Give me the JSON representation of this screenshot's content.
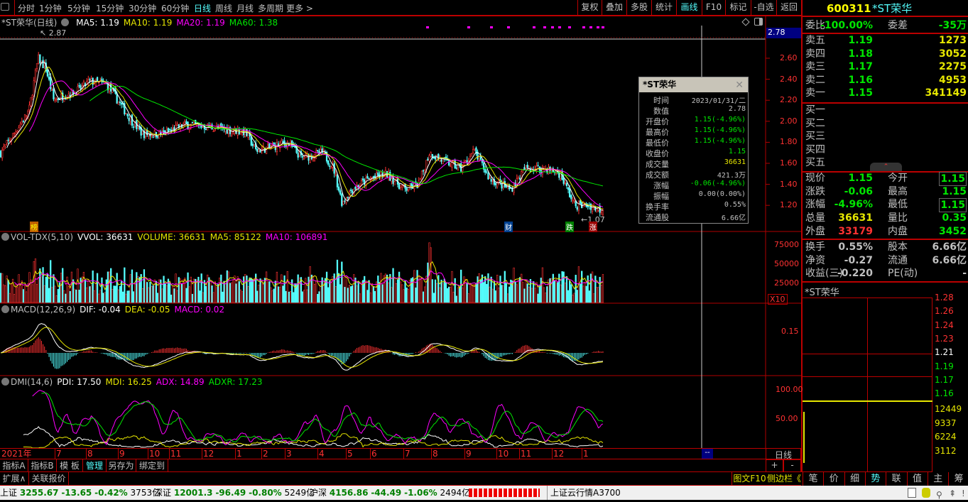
{
  "toolbar": {
    "periods": [
      "分时",
      "1分钟",
      "5分钟",
      "15分钟",
      "30分钟",
      "60分钟",
      "日线",
      "周线",
      "月线",
      "多周期",
      "更多 >"
    ],
    "active": "日线",
    "buttons": [
      "复权",
      "叠加",
      "多股",
      "统计",
      "画线",
      "F10",
      "标记",
      "-自选",
      "返回"
    ]
  },
  "main": {
    "title": "*ST荣华(日线)",
    "ma5": "MA5: 1.19",
    "ma10": "MA10: 1.19",
    "ma20": "MA20: 1.19",
    "ma60": "MA60: 1.38",
    "high_mark": "2.87",
    "low_mark": "1.07",
    "cursor_value": "2.78",
    "price_ticks": [
      "2.60",
      "2.40",
      "2.20",
      "2.00",
      "1.80",
      "1.60",
      "1.40",
      "1.20"
    ],
    "badges": [
      "榜",
      "财",
      "跌",
      "涨"
    ]
  },
  "vol": {
    "name": "VOL-TDX(5,10)",
    "vvol": "VVOL: 36631",
    "volume": "VOLUME: 36631",
    "ma5": "MA5: 85122",
    "ma10": "MA10: 106891",
    "ticks": [
      "75000",
      "50000",
      "25000"
    ],
    "unit": "X10"
  },
  "macd": {
    "name": "MACD(12,26,9)",
    "dif": "DIF: -0.04",
    "dea": "DEA: -0.05",
    "macd": "MACD: 0.02",
    "tick": "0.15"
  },
  "dmi": {
    "name": "DMI(14,6)",
    "pdi": "PDI: 17.50",
    "mdi": "MDI: 16.25",
    "adx": "ADX: 14.89",
    "adxr": "ADXR: 17.23",
    "ticks": [
      "100.00",
      "50.00"
    ]
  },
  "xaxis": {
    "labels": [
      "2021年",
      "7",
      "8",
      "9",
      "10",
      "11",
      "12",
      "1",
      "2",
      "3",
      "4",
      "5",
      "6",
      "7",
      "8",
      "9",
      "10",
      "11",
      "12",
      "1"
    ],
    "cursor": "--",
    "period": "日线",
    "plus": "+",
    "minus": "-"
  },
  "bottom_tabs": [
    "指标A",
    "指标B",
    "模 板",
    "管理",
    "另存为",
    "绑定到"
  ],
  "ext_tabs": [
    "扩展∧",
    "关联报价"
  ],
  "tooltip": {
    "title": "*ST荣华",
    "rows": [
      {
        "k": "时间",
        "v": "2023/01/31/二",
        "c": "#c0c0c0"
      },
      {
        "k": "数值",
        "v": "2.78",
        "c": "#c0c0c0"
      },
      {
        "k": "开盘价",
        "v": "1.15(-4.96%)",
        "c": "#00e600"
      },
      {
        "k": "最高价",
        "v": "1.15(-4.96%)",
        "c": "#00e600"
      },
      {
        "k": "最低价",
        "v": "1.15(-4.96%)",
        "c": "#00e600"
      },
      {
        "k": "收盘价",
        "v": "1.15",
        "c": "#00e600"
      },
      {
        "k": "成交量",
        "v": "36631",
        "c": "#e6e600"
      },
      {
        "k": "成交额",
        "v": "421.3万",
        "c": "#c0c0c0"
      },
      {
        "k": "涨幅",
        "v": "-0.06(-4.96%)",
        "c": "#00e600"
      },
      {
        "k": "振幅",
        "v": "0.00(0.00%)",
        "c": "#c0c0c0"
      },
      {
        "k": "换手率",
        "v": "0.55%",
        "c": "#c0c0c0"
      },
      {
        "k": "流通股",
        "v": "6.66亿",
        "c": "#c0c0c0"
      }
    ]
  },
  "quote": {
    "code": "600311",
    "name": "*ST荣华",
    "weibi": {
      "l": "委比",
      "v": "-100.00%",
      "l2": "委差",
      "v2": "-35万"
    },
    "sells": [
      {
        "l": "卖五",
        "p": "1.19",
        "q": "1273"
      },
      {
        "l": "卖四",
        "p": "1.18",
        "q": "3052"
      },
      {
        "l": "卖三",
        "p": "1.17",
        "q": "2275"
      },
      {
        "l": "卖二",
        "p": "1.16",
        "q": "4953"
      },
      {
        "l": "卖一",
        "p": "1.15",
        "q": "341149"
      }
    ],
    "buys": [
      {
        "l": "买一"
      },
      {
        "l": "买二"
      },
      {
        "l": "买三"
      },
      {
        "l": "买四"
      },
      {
        "l": "买五"
      }
    ],
    "stats": [
      {
        "l": "现价",
        "v": "1.15",
        "l2": "今开",
        "v2": "1.15",
        "c": "g",
        "c2": "g"
      },
      {
        "l": "涨跌",
        "v": "-0.06",
        "l2": "最高",
        "v2": "1.15",
        "c": "g",
        "c2": "g"
      },
      {
        "l": "涨幅",
        "v": "-4.96%",
        "l2": "最低",
        "v2": "1.15",
        "c": "g",
        "c2": "g"
      },
      {
        "l": "总量",
        "v": "36631",
        "l2": "量比",
        "v2": "0.35",
        "c": "y",
        "c2": "g"
      },
      {
        "l": "外盘",
        "v": "33179",
        "l2": "内盘",
        "v2": "3452",
        "c": "r",
        "c2": "g"
      }
    ],
    "fin": [
      {
        "l": "换手",
        "v": "0.55%",
        "l2": "股本",
        "v2": "6.66亿"
      },
      {
        "l": "净资",
        "v": "-0.27",
        "l2": "流通",
        "v2": "6.66亿"
      },
      {
        "l": "收益(三)",
        "v": "-0.220",
        "l2": "PE(动)",
        "v2": "-"
      }
    ]
  },
  "mini": {
    "title": "*ST荣华",
    "ticks": [
      "1.28",
      "1.26",
      "1.24",
      "1.23",
      "1.21",
      "1.19",
      "1.17",
      "1.16"
    ],
    "vticks": [
      "12449",
      "9337",
      "6224",
      "3112"
    ]
  },
  "side_tabs": {
    "f10": "图文F10",
    "sidebar": "侧边栏《",
    "tabs": [
      "笔",
      "价",
      "细",
      "势",
      "联",
      "值",
      "主",
      "筹"
    ]
  },
  "status": {
    "sh": "上证",
    "sh_v": "3255.67",
    "sh_c": "-13.65",
    "sh_p": "-0.42%",
    "sh_a": "3753亿",
    "sz": "深证",
    "sz_v": "12001.3",
    "sz_c": "-96.49",
    "sz_p": "-0.80%",
    "sz_a": "5249亿",
    "hs": "沪深",
    "hs_v": "4156.86",
    "hs_c": "-44.49",
    "hs_p": "-1.06%",
    "hs_a": "2494亿",
    "cloud": "上证云行情A3700"
  },
  "chart_data": {
    "type": "candlestick",
    "ylim": [
      1.07,
      2.87
    ],
    "days": 400,
    "price_path": [
      [
        0,
        1.7
      ],
      [
        0.024,
        1.9
      ],
      [
        0.047,
        2.1
      ],
      [
        0.062,
        2.6
      ],
      [
        0.075,
        2.5
      ],
      [
        0.088,
        2.2
      ],
      [
        0.106,
        2.25
      ],
      [
        0.13,
        2.3
      ],
      [
        0.147,
        2.38
      ],
      [
        0.176,
        2.35
      ],
      [
        0.194,
        2.2
      ],
      [
        0.218,
        2.0
      ],
      [
        0.235,
        1.88
      ],
      [
        0.27,
        1.88
      ],
      [
        0.306,
        1.97
      ],
      [
        0.34,
        1.95
      ],
      [
        0.376,
        1.92
      ],
      [
        0.406,
        1.9
      ],
      [
        0.424,
        1.72
      ],
      [
        0.447,
        1.75
      ],
      [
        0.476,
        1.8
      ],
      [
        0.5,
        1.65
      ],
      [
        0.535,
        1.7
      ],
      [
        0.553,
        1.55
      ],
      [
        0.567,
        1.22
      ],
      [
        0.582,
        1.35
      ],
      [
        0.612,
        1.45
      ],
      [
        0.641,
        1.5
      ],
      [
        0.671,
        1.35
      ],
      [
        0.694,
        1.4
      ],
      [
        0.712,
        1.7
      ],
      [
        0.735,
        1.62
      ],
      [
        0.765,
        1.55
      ],
      [
        0.786,
        1.72
      ],
      [
        0.812,
        1.45
      ],
      [
        0.847,
        1.35
      ],
      [
        0.871,
        1.55
      ],
      [
        0.906,
        1.55
      ],
      [
        0.929,
        1.5
      ],
      [
        0.953,
        1.2
      ],
      [
        0.976,
        1.2
      ],
      [
        1,
        1.15
      ]
    ]
  },
  "colors": {
    "up": "#ff3232",
    "down": "#54fcfc",
    "ma5": "#ffffff",
    "ma10": "#e6e600",
    "ma20": "#ff00ff",
    "ma60": "#00e600",
    "grid": "#b00000"
  }
}
